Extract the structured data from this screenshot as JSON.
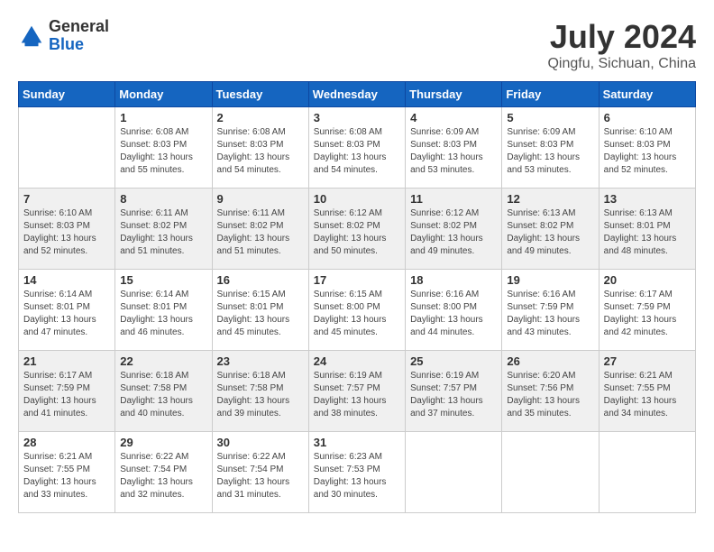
{
  "header": {
    "logo_general": "General",
    "logo_blue": "Blue",
    "title": "July 2024",
    "location": "Qingfu, Sichuan, China"
  },
  "days_of_week": [
    "Sunday",
    "Monday",
    "Tuesday",
    "Wednesday",
    "Thursday",
    "Friday",
    "Saturday"
  ],
  "weeks": [
    [
      {
        "day": "",
        "info": ""
      },
      {
        "day": "1",
        "info": "Sunrise: 6:08 AM\nSunset: 8:03 PM\nDaylight: 13 hours\nand 55 minutes."
      },
      {
        "day": "2",
        "info": "Sunrise: 6:08 AM\nSunset: 8:03 PM\nDaylight: 13 hours\nand 54 minutes."
      },
      {
        "day": "3",
        "info": "Sunrise: 6:08 AM\nSunset: 8:03 PM\nDaylight: 13 hours\nand 54 minutes."
      },
      {
        "day": "4",
        "info": "Sunrise: 6:09 AM\nSunset: 8:03 PM\nDaylight: 13 hours\nand 53 minutes."
      },
      {
        "day": "5",
        "info": "Sunrise: 6:09 AM\nSunset: 8:03 PM\nDaylight: 13 hours\nand 53 minutes."
      },
      {
        "day": "6",
        "info": "Sunrise: 6:10 AM\nSunset: 8:03 PM\nDaylight: 13 hours\nand 52 minutes."
      }
    ],
    [
      {
        "day": "7",
        "info": "Sunrise: 6:10 AM\nSunset: 8:03 PM\nDaylight: 13 hours\nand 52 minutes."
      },
      {
        "day": "8",
        "info": "Sunrise: 6:11 AM\nSunset: 8:02 PM\nDaylight: 13 hours\nand 51 minutes."
      },
      {
        "day": "9",
        "info": "Sunrise: 6:11 AM\nSunset: 8:02 PM\nDaylight: 13 hours\nand 51 minutes."
      },
      {
        "day": "10",
        "info": "Sunrise: 6:12 AM\nSunset: 8:02 PM\nDaylight: 13 hours\nand 50 minutes."
      },
      {
        "day": "11",
        "info": "Sunrise: 6:12 AM\nSunset: 8:02 PM\nDaylight: 13 hours\nand 49 minutes."
      },
      {
        "day": "12",
        "info": "Sunrise: 6:13 AM\nSunset: 8:02 PM\nDaylight: 13 hours\nand 49 minutes."
      },
      {
        "day": "13",
        "info": "Sunrise: 6:13 AM\nSunset: 8:01 PM\nDaylight: 13 hours\nand 48 minutes."
      }
    ],
    [
      {
        "day": "14",
        "info": "Sunrise: 6:14 AM\nSunset: 8:01 PM\nDaylight: 13 hours\nand 47 minutes."
      },
      {
        "day": "15",
        "info": "Sunrise: 6:14 AM\nSunset: 8:01 PM\nDaylight: 13 hours\nand 46 minutes."
      },
      {
        "day": "16",
        "info": "Sunrise: 6:15 AM\nSunset: 8:01 PM\nDaylight: 13 hours\nand 45 minutes."
      },
      {
        "day": "17",
        "info": "Sunrise: 6:15 AM\nSunset: 8:00 PM\nDaylight: 13 hours\nand 45 minutes."
      },
      {
        "day": "18",
        "info": "Sunrise: 6:16 AM\nSunset: 8:00 PM\nDaylight: 13 hours\nand 44 minutes."
      },
      {
        "day": "19",
        "info": "Sunrise: 6:16 AM\nSunset: 7:59 PM\nDaylight: 13 hours\nand 43 minutes."
      },
      {
        "day": "20",
        "info": "Sunrise: 6:17 AM\nSunset: 7:59 PM\nDaylight: 13 hours\nand 42 minutes."
      }
    ],
    [
      {
        "day": "21",
        "info": "Sunrise: 6:17 AM\nSunset: 7:59 PM\nDaylight: 13 hours\nand 41 minutes."
      },
      {
        "day": "22",
        "info": "Sunrise: 6:18 AM\nSunset: 7:58 PM\nDaylight: 13 hours\nand 40 minutes."
      },
      {
        "day": "23",
        "info": "Sunrise: 6:18 AM\nSunset: 7:58 PM\nDaylight: 13 hours\nand 39 minutes."
      },
      {
        "day": "24",
        "info": "Sunrise: 6:19 AM\nSunset: 7:57 PM\nDaylight: 13 hours\nand 38 minutes."
      },
      {
        "day": "25",
        "info": "Sunrise: 6:19 AM\nSunset: 7:57 PM\nDaylight: 13 hours\nand 37 minutes."
      },
      {
        "day": "26",
        "info": "Sunrise: 6:20 AM\nSunset: 7:56 PM\nDaylight: 13 hours\nand 35 minutes."
      },
      {
        "day": "27",
        "info": "Sunrise: 6:21 AM\nSunset: 7:55 PM\nDaylight: 13 hours\nand 34 minutes."
      }
    ],
    [
      {
        "day": "28",
        "info": "Sunrise: 6:21 AM\nSunset: 7:55 PM\nDaylight: 13 hours\nand 33 minutes."
      },
      {
        "day": "29",
        "info": "Sunrise: 6:22 AM\nSunset: 7:54 PM\nDaylight: 13 hours\nand 32 minutes."
      },
      {
        "day": "30",
        "info": "Sunrise: 6:22 AM\nSunset: 7:54 PM\nDaylight: 13 hours\nand 31 minutes."
      },
      {
        "day": "31",
        "info": "Sunrise: 6:23 AM\nSunset: 7:53 PM\nDaylight: 13 hours\nand 30 minutes."
      },
      {
        "day": "",
        "info": ""
      },
      {
        "day": "",
        "info": ""
      },
      {
        "day": "",
        "info": ""
      }
    ]
  ]
}
